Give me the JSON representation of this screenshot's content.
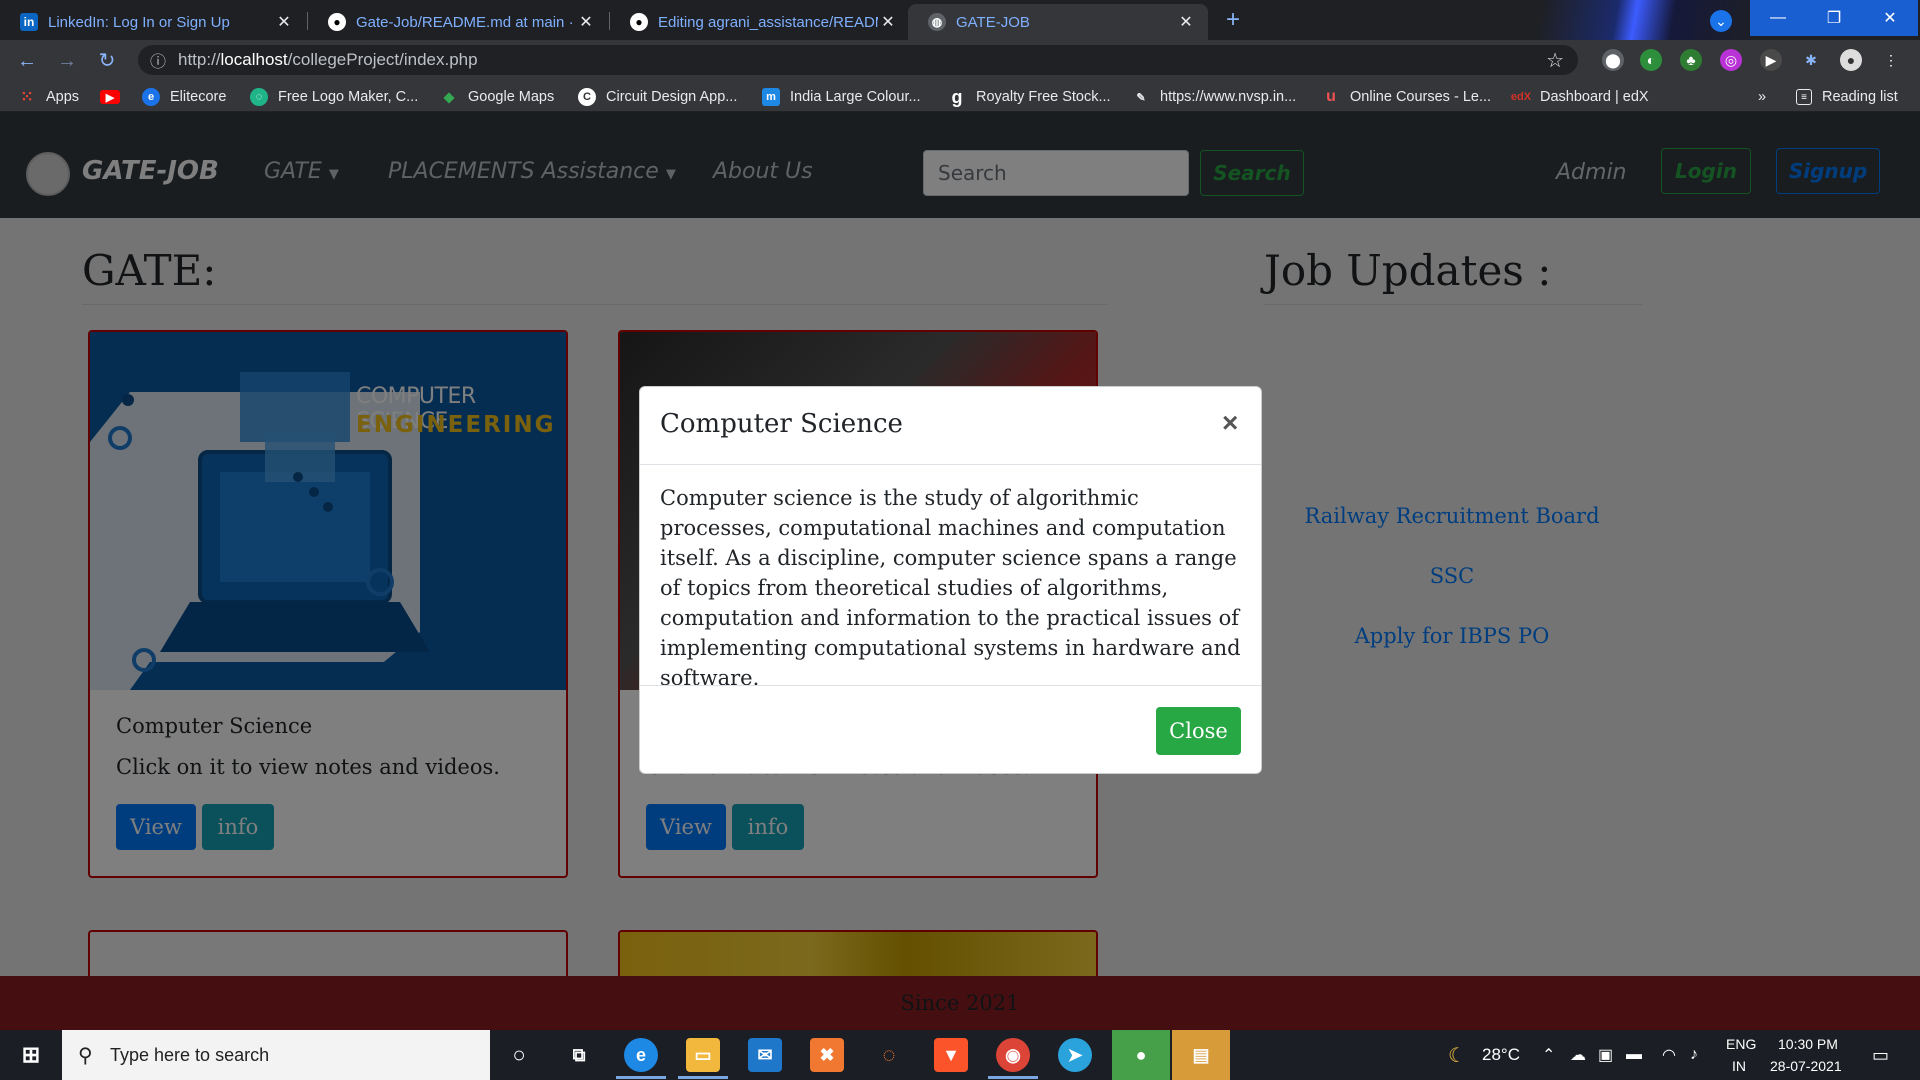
{
  "browser": {
    "tabs": [
      {
        "title": "LinkedIn: Log In or Sign Up",
        "icon": "linkedin-icon"
      },
      {
        "title": "Gate-Job/README.md at main · t",
        "icon": "github-icon"
      },
      {
        "title": "Editing agrani_assistance/READM",
        "icon": "github-icon"
      },
      {
        "title": "GATE-JOB",
        "icon": "globe-icon"
      }
    ],
    "new_tab": "+",
    "url_prefix": "http://",
    "url_host": "localhost",
    "url_path": "/collegeProject/index.php",
    "bookmarks": [
      "Apps",
      "",
      "Elitecore",
      "Free Logo Maker, C...",
      "Google Maps",
      "Circuit Design App...",
      "India Large Colour...",
      "Royalty Free Stock...",
      "https://www.nvsp.in...",
      "Online Courses - Le...",
      "Dashboard | edX"
    ],
    "more_bookmarks": "»",
    "reading_list": "Reading list"
  },
  "navbar": {
    "brand": "GATE-JOB",
    "items": [
      "GATE",
      "PLACEMENTS Assistance",
      "About Us"
    ],
    "search_placeholder": "Search",
    "search_button": "Search",
    "admin": "Admin",
    "login": "Login",
    "signup": "Signup"
  },
  "main": {
    "gate_heading": "GATE:",
    "job_heading": "Job Updates :",
    "cards": [
      {
        "image_caption_1": "COMPUTER SCIENCE",
        "image_caption_2": "ENGINEERING",
        "title": "Computer Science",
        "text": "Click on it to view notes and videos.",
        "view": "View",
        "info": "info"
      },
      {
        "title": "",
        "text": "Click on it to view notes and videos.",
        "view": "View",
        "info": "info"
      }
    ],
    "job_links": [
      "Railway Recruitment Board",
      "SSC",
      "Apply for IBPS PO"
    ],
    "footer": "Since 2021"
  },
  "modal": {
    "title": "Computer Science",
    "close_x": "×",
    "body": "Computer science is the study of algorithmic processes, computational machines and computation itself. As a discipline, computer science spans a range of topics from theoretical studies of algorithms, computation and information to the practical issues of implementing computational systems in hardware and software.",
    "close_button": "Close"
  },
  "taskbar": {
    "search_placeholder": "Type here to search",
    "weather": "28°C",
    "lang_1": "ENG",
    "lang_2": "IN",
    "time": "10:30 PM",
    "date": "28-07-2021"
  },
  "colors": {
    "navbar_bg": "#343a40",
    "card_border": "#c00000",
    "primary": "#007bff",
    "info": "#17a2b8",
    "success": "#28a745",
    "footer": "#8a1e22"
  }
}
